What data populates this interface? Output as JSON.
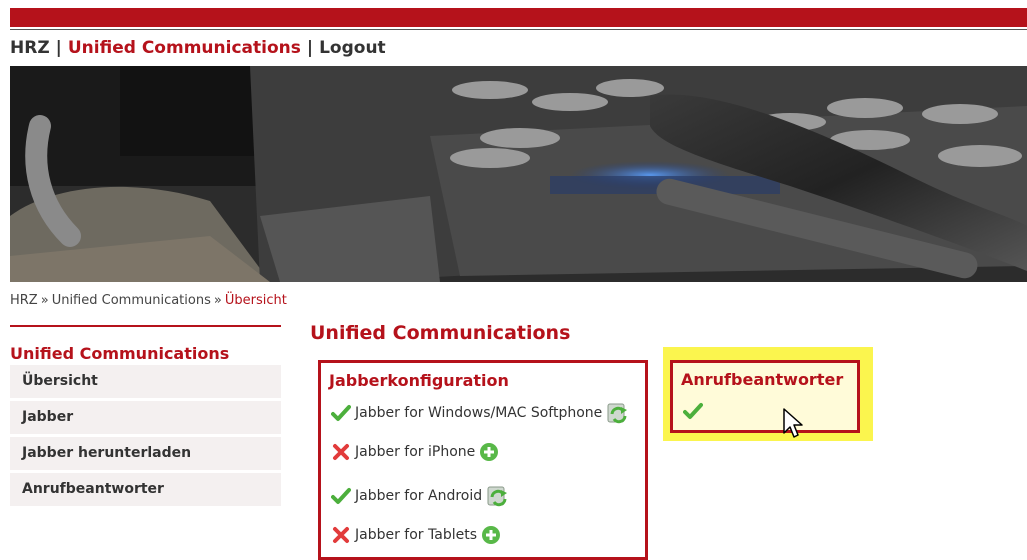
{
  "topnav": {
    "hrz": "HRZ",
    "sep1": "|",
    "uc": "Unified Communications",
    "sep2": "|",
    "logout": "Logout"
  },
  "breadcrumb": {
    "hrz": "HRZ",
    "sep1": "»",
    "uc": "Unified Communications",
    "sep2": "»",
    "current": "Übersicht"
  },
  "sidebar": {
    "title": "Unified Communications",
    "items": [
      {
        "label": "Übersicht"
      },
      {
        "label": "Jabber"
      },
      {
        "label": "Jabber herunterladen"
      },
      {
        "label": "Anrufbeantworter"
      }
    ]
  },
  "main": {
    "title": "Unified Communications",
    "jabber": {
      "title": "Jabberkonfiguration",
      "items": [
        {
          "label": "Jabber for Windows/MAC Softphone",
          "status": "configured",
          "action": "refresh"
        },
        {
          "label": "Jabber for iPhone",
          "status": "not-configured",
          "action": "add"
        },
        {
          "label": "Jabber for Android",
          "status": "configured",
          "action": "refresh"
        },
        {
          "label": "Jabber for Tablets",
          "status": "not-configured",
          "action": "add"
        }
      ]
    },
    "voicemail": {
      "title": "Anrufbeantworter",
      "status": "configured"
    }
  },
  "colors": {
    "brand": "#b5121b",
    "highlight": "#fbf54e",
    "check": "#4caf3c",
    "cross": "#e23b3b",
    "add": "#58b848"
  }
}
